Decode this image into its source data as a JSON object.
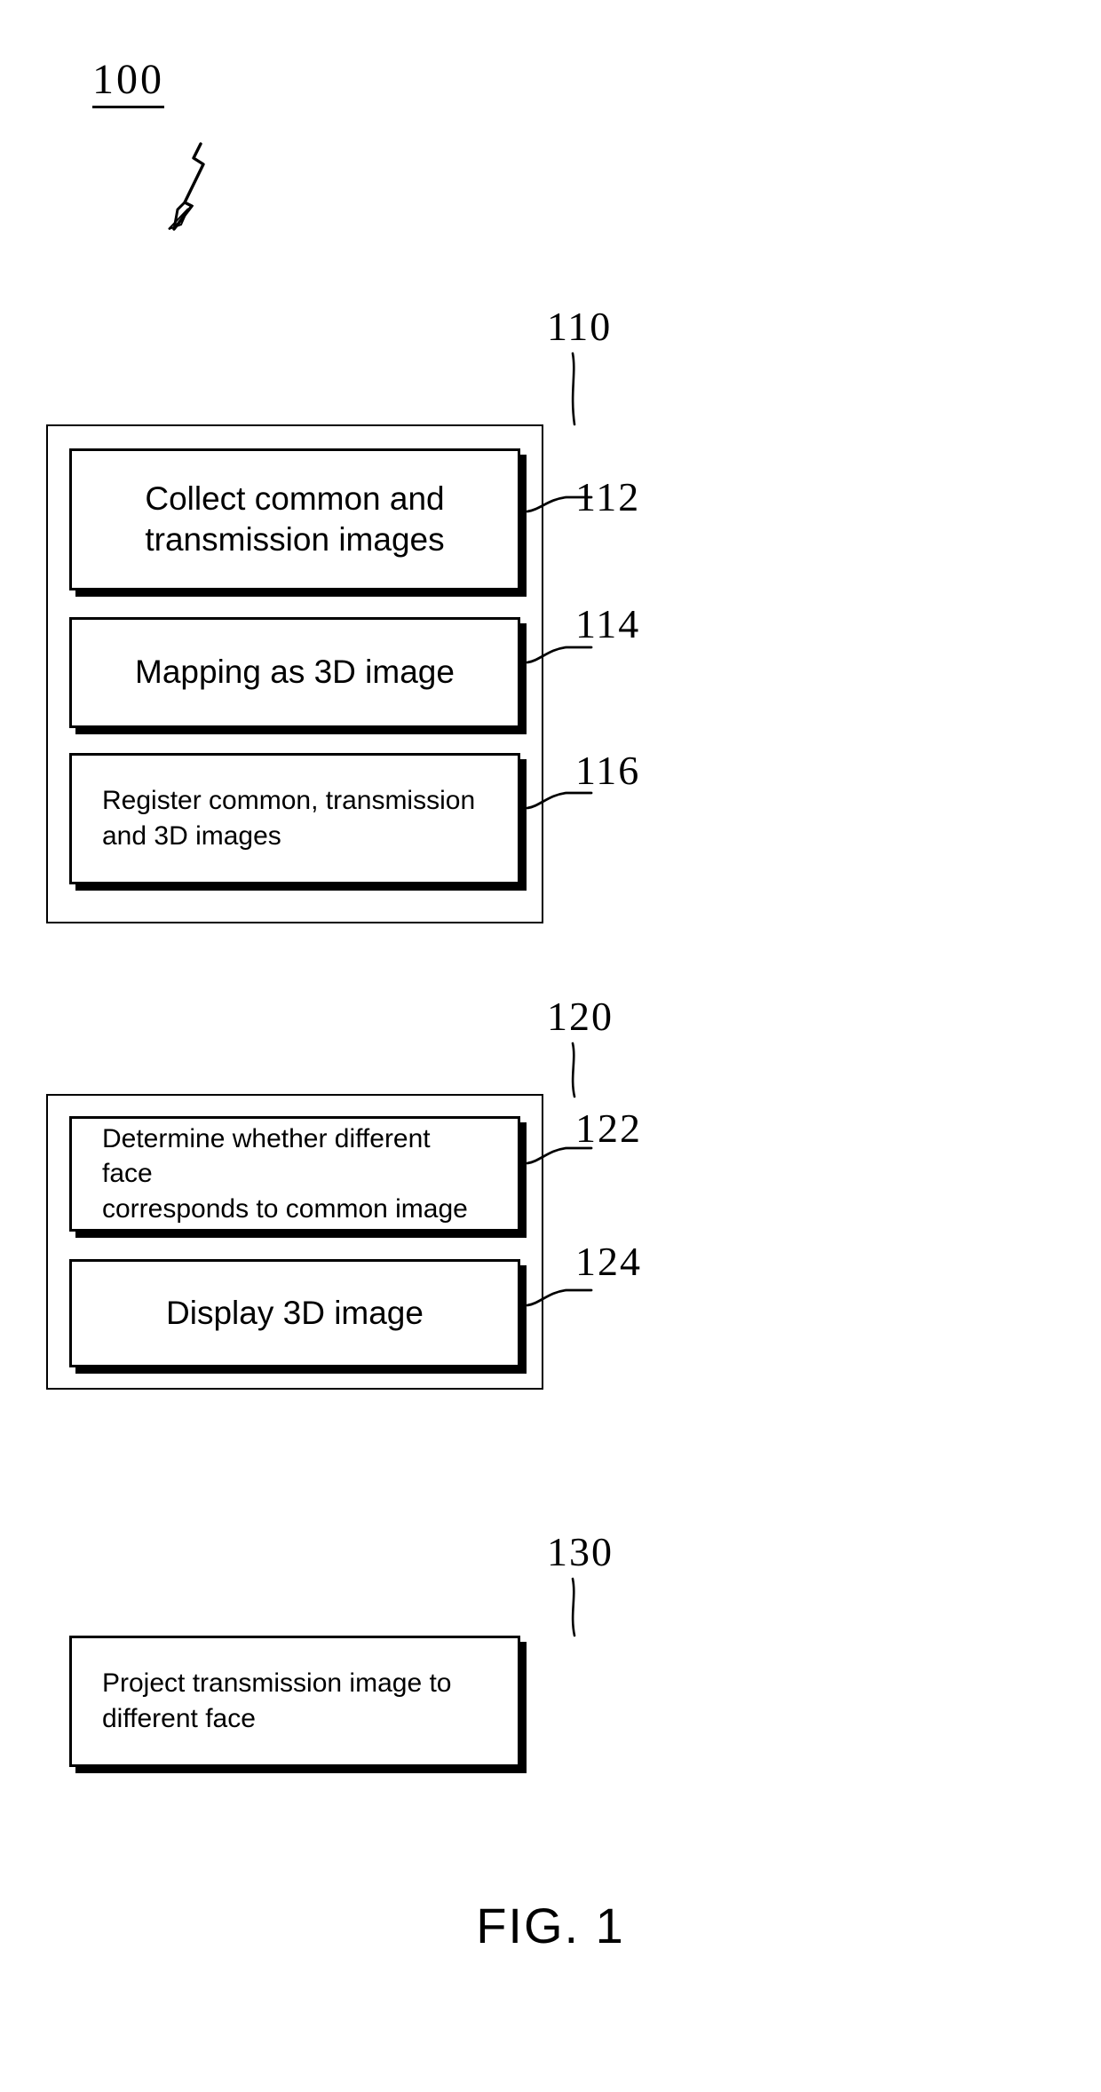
{
  "figure": {
    "caption": "FIG. 1",
    "system_label": "100"
  },
  "groups": [
    {
      "ref": "110",
      "steps": [
        {
          "ref": "112",
          "text": "Collect common and\ntransmission images",
          "align": "center"
        },
        {
          "ref": "114",
          "text": "Mapping as 3D image",
          "align": "center"
        },
        {
          "ref": "116",
          "text": "Register common, transmission\nand 3D images",
          "align": "left"
        }
      ]
    },
    {
      "ref": "120",
      "steps": [
        {
          "ref": "122",
          "text": "Determine whether different face\ncorresponds to common image",
          "align": "left"
        },
        {
          "ref": "124",
          "text": "Display 3D image",
          "align": "center"
        }
      ]
    }
  ],
  "standalone_steps": [
    {
      "ref": "130",
      "text": "Project transmission image to\ndifferent face",
      "align": "left"
    }
  ],
  "labels": {
    "l100": "100",
    "l110": "110",
    "l112": "112",
    "l114": "114",
    "l116": "116",
    "l120": "120",
    "l122": "122",
    "l124": "124",
    "l130": "130"
  },
  "text": {
    "t112": "Collect common and",
    "t112b": "transmission images",
    "t114": "Mapping as 3D image",
    "t116": "Register common, transmission",
    "t116b": "and 3D images",
    "t122": "Determine whether different face",
    "t122b": "corresponds to common image",
    "t124": "Display 3D image",
    "t130": "Project transmission image to",
    "t130b": "different face"
  },
  "colors": {
    "ink": "#000000",
    "paper": "#ffffff"
  }
}
